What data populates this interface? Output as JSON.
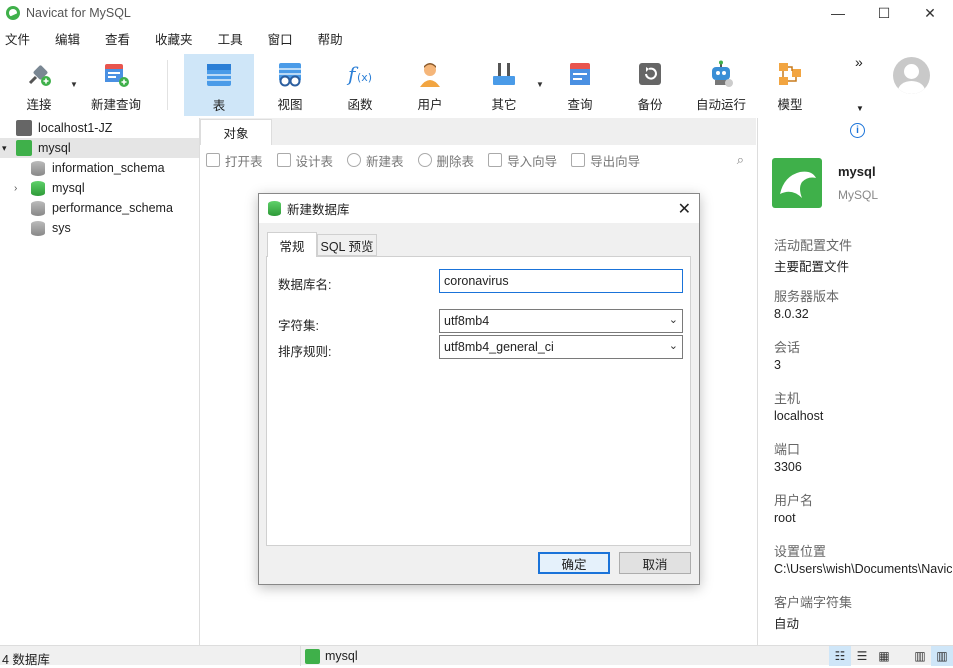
{
  "window": {
    "title": "Navicat for MySQL",
    "min": "—",
    "max": "☐",
    "close": "✕"
  },
  "menu": [
    "文件",
    "编辑",
    "查看",
    "收藏夹",
    "工具",
    "窗口",
    "帮助"
  ],
  "toolbar": {
    "connect": "连接",
    "new_query": "新建查询",
    "table": "表",
    "view": "视图",
    "function": "函数",
    "user": "用户",
    "other": "其它",
    "query": "查询",
    "backup": "备份",
    "auto_run": "自动运行",
    "model": "模型",
    "more": "»"
  },
  "tree": {
    "items": [
      {
        "label": "localhost1-JZ"
      },
      {
        "label": "mysql"
      },
      {
        "label": "information_schema"
      },
      {
        "label": "mysql"
      },
      {
        "label": "performance_schema"
      },
      {
        "label": "sys"
      }
    ]
  },
  "center": {
    "tab": "对象",
    "actions": {
      "open": "打开表",
      "design": "设计表",
      "new": "新建表",
      "delete": "删除表",
      "import": "导入向导",
      "export": "导出向导"
    }
  },
  "dialog": {
    "title": "新建数据库",
    "tabs": {
      "general": "常规",
      "sql": "SQL 预览"
    },
    "fields": {
      "name_label": "数据库名:",
      "name_value": "coronavirus",
      "charset_label": "字符集:",
      "charset_value": "utf8mb4",
      "collation_label": "排序规则:",
      "collation_value": "utf8mb4_general_ci"
    },
    "ok": "确定",
    "cancel": "取消"
  },
  "right": {
    "name": "mysql",
    "type": "MySQL",
    "props": [
      {
        "label": "活动配置文件",
        "value": "主要配置文件"
      },
      {
        "label": "服务器版本",
        "value": "8.0.32"
      },
      {
        "label": "会话",
        "value": "3"
      },
      {
        "label": "主机",
        "value": "localhost"
      },
      {
        "label": "端口",
        "value": "3306"
      },
      {
        "label": "用户名",
        "value": "root"
      },
      {
        "label": "设置位置",
        "value": "C:\\Users\\wish\\Documents\\Navicat"
      },
      {
        "label": "客户端字符集",
        "value": "自动"
      }
    ]
  },
  "status": {
    "count": "4 数据库",
    "current": "mysql"
  },
  "colors": {
    "accent": "#1a73d9",
    "mysql_green": "#3fb04a",
    "active_tool": "#cfe6f8"
  }
}
